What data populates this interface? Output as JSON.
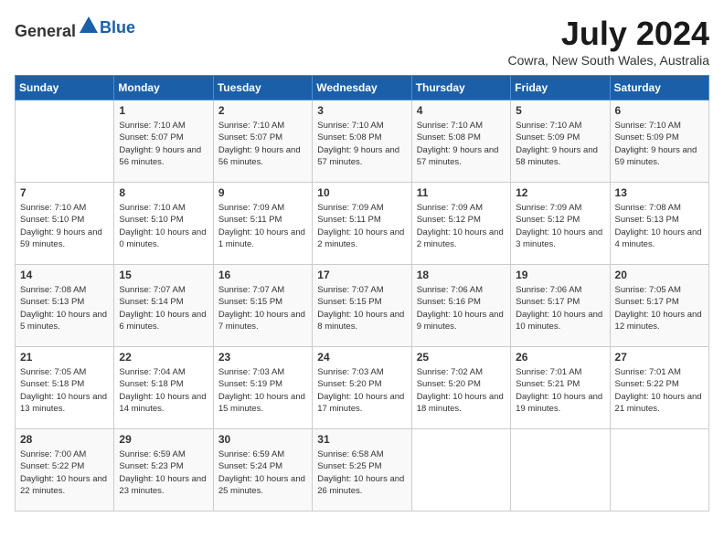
{
  "header": {
    "logo_general": "General",
    "logo_blue": "Blue",
    "month_title": "July 2024",
    "location": "Cowra, New South Wales, Australia"
  },
  "days_of_week": [
    "Sunday",
    "Monday",
    "Tuesday",
    "Wednesday",
    "Thursday",
    "Friday",
    "Saturday"
  ],
  "weeks": [
    [
      {
        "num": "",
        "sunrise": "",
        "sunset": "",
        "daylight": ""
      },
      {
        "num": "1",
        "sunrise": "Sunrise: 7:10 AM",
        "sunset": "Sunset: 5:07 PM",
        "daylight": "Daylight: 9 hours and 56 minutes."
      },
      {
        "num": "2",
        "sunrise": "Sunrise: 7:10 AM",
        "sunset": "Sunset: 5:07 PM",
        "daylight": "Daylight: 9 hours and 56 minutes."
      },
      {
        "num": "3",
        "sunrise": "Sunrise: 7:10 AM",
        "sunset": "Sunset: 5:08 PM",
        "daylight": "Daylight: 9 hours and 57 minutes."
      },
      {
        "num": "4",
        "sunrise": "Sunrise: 7:10 AM",
        "sunset": "Sunset: 5:08 PM",
        "daylight": "Daylight: 9 hours and 57 minutes."
      },
      {
        "num": "5",
        "sunrise": "Sunrise: 7:10 AM",
        "sunset": "Sunset: 5:09 PM",
        "daylight": "Daylight: 9 hours and 58 minutes."
      },
      {
        "num": "6",
        "sunrise": "Sunrise: 7:10 AM",
        "sunset": "Sunset: 5:09 PM",
        "daylight": "Daylight: 9 hours and 59 minutes."
      }
    ],
    [
      {
        "num": "7",
        "sunrise": "Sunrise: 7:10 AM",
        "sunset": "Sunset: 5:10 PM",
        "daylight": "Daylight: 9 hours and 59 minutes."
      },
      {
        "num": "8",
        "sunrise": "Sunrise: 7:10 AM",
        "sunset": "Sunset: 5:10 PM",
        "daylight": "Daylight: 10 hours and 0 minutes."
      },
      {
        "num": "9",
        "sunrise": "Sunrise: 7:09 AM",
        "sunset": "Sunset: 5:11 PM",
        "daylight": "Daylight: 10 hours and 1 minute."
      },
      {
        "num": "10",
        "sunrise": "Sunrise: 7:09 AM",
        "sunset": "Sunset: 5:11 PM",
        "daylight": "Daylight: 10 hours and 2 minutes."
      },
      {
        "num": "11",
        "sunrise": "Sunrise: 7:09 AM",
        "sunset": "Sunset: 5:12 PM",
        "daylight": "Daylight: 10 hours and 2 minutes."
      },
      {
        "num": "12",
        "sunrise": "Sunrise: 7:09 AM",
        "sunset": "Sunset: 5:12 PM",
        "daylight": "Daylight: 10 hours and 3 minutes."
      },
      {
        "num": "13",
        "sunrise": "Sunrise: 7:08 AM",
        "sunset": "Sunset: 5:13 PM",
        "daylight": "Daylight: 10 hours and 4 minutes."
      }
    ],
    [
      {
        "num": "14",
        "sunrise": "Sunrise: 7:08 AM",
        "sunset": "Sunset: 5:13 PM",
        "daylight": "Daylight: 10 hours and 5 minutes."
      },
      {
        "num": "15",
        "sunrise": "Sunrise: 7:07 AM",
        "sunset": "Sunset: 5:14 PM",
        "daylight": "Daylight: 10 hours and 6 minutes."
      },
      {
        "num": "16",
        "sunrise": "Sunrise: 7:07 AM",
        "sunset": "Sunset: 5:15 PM",
        "daylight": "Daylight: 10 hours and 7 minutes."
      },
      {
        "num": "17",
        "sunrise": "Sunrise: 7:07 AM",
        "sunset": "Sunset: 5:15 PM",
        "daylight": "Daylight: 10 hours and 8 minutes."
      },
      {
        "num": "18",
        "sunrise": "Sunrise: 7:06 AM",
        "sunset": "Sunset: 5:16 PM",
        "daylight": "Daylight: 10 hours and 9 minutes."
      },
      {
        "num": "19",
        "sunrise": "Sunrise: 7:06 AM",
        "sunset": "Sunset: 5:17 PM",
        "daylight": "Daylight: 10 hours and 10 minutes."
      },
      {
        "num": "20",
        "sunrise": "Sunrise: 7:05 AM",
        "sunset": "Sunset: 5:17 PM",
        "daylight": "Daylight: 10 hours and 12 minutes."
      }
    ],
    [
      {
        "num": "21",
        "sunrise": "Sunrise: 7:05 AM",
        "sunset": "Sunset: 5:18 PM",
        "daylight": "Daylight: 10 hours and 13 minutes."
      },
      {
        "num": "22",
        "sunrise": "Sunrise: 7:04 AM",
        "sunset": "Sunset: 5:18 PM",
        "daylight": "Daylight: 10 hours and 14 minutes."
      },
      {
        "num": "23",
        "sunrise": "Sunrise: 7:03 AM",
        "sunset": "Sunset: 5:19 PM",
        "daylight": "Daylight: 10 hours and 15 minutes."
      },
      {
        "num": "24",
        "sunrise": "Sunrise: 7:03 AM",
        "sunset": "Sunset: 5:20 PM",
        "daylight": "Daylight: 10 hours and 17 minutes."
      },
      {
        "num": "25",
        "sunrise": "Sunrise: 7:02 AM",
        "sunset": "Sunset: 5:20 PM",
        "daylight": "Daylight: 10 hours and 18 minutes."
      },
      {
        "num": "26",
        "sunrise": "Sunrise: 7:01 AM",
        "sunset": "Sunset: 5:21 PM",
        "daylight": "Daylight: 10 hours and 19 minutes."
      },
      {
        "num": "27",
        "sunrise": "Sunrise: 7:01 AM",
        "sunset": "Sunset: 5:22 PM",
        "daylight": "Daylight: 10 hours and 21 minutes."
      }
    ],
    [
      {
        "num": "28",
        "sunrise": "Sunrise: 7:00 AM",
        "sunset": "Sunset: 5:22 PM",
        "daylight": "Daylight: 10 hours and 22 minutes."
      },
      {
        "num": "29",
        "sunrise": "Sunrise: 6:59 AM",
        "sunset": "Sunset: 5:23 PM",
        "daylight": "Daylight: 10 hours and 23 minutes."
      },
      {
        "num": "30",
        "sunrise": "Sunrise: 6:59 AM",
        "sunset": "Sunset: 5:24 PM",
        "daylight": "Daylight: 10 hours and 25 minutes."
      },
      {
        "num": "31",
        "sunrise": "Sunrise: 6:58 AM",
        "sunset": "Sunset: 5:25 PM",
        "daylight": "Daylight: 10 hours and 26 minutes."
      },
      {
        "num": "",
        "sunrise": "",
        "sunset": "",
        "daylight": ""
      },
      {
        "num": "",
        "sunrise": "",
        "sunset": "",
        "daylight": ""
      },
      {
        "num": "",
        "sunrise": "",
        "sunset": "",
        "daylight": ""
      }
    ]
  ]
}
